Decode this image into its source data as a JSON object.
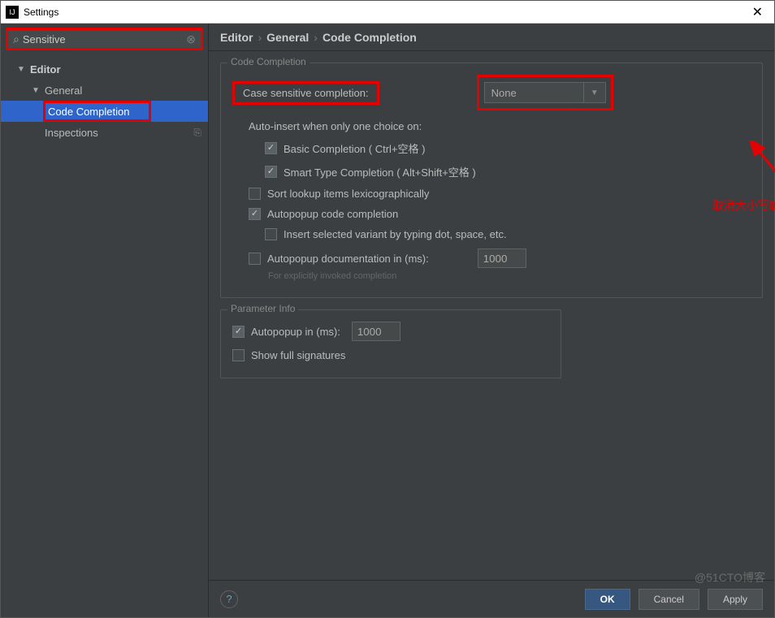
{
  "titlebar": {
    "title": "Settings"
  },
  "search": {
    "value": "Sensitive"
  },
  "tree": {
    "editor": "Editor",
    "general": "General",
    "code_completion": "Code Completion",
    "inspections": "Inspections"
  },
  "breadcrumb": {
    "p1": "Editor",
    "p2": "General",
    "p3": "Code Completion"
  },
  "section": {
    "code_completion_legend": "Code Completion",
    "case_sensitive_label": "Case sensitive completion:",
    "case_sensitive_value": "None",
    "auto_insert_label": "Auto-insert when only one choice on:",
    "basic_completion": "Basic Completion ( Ctrl+空格 )",
    "smart_type_completion": "Smart Type Completion ( Alt+Shift+空格 )",
    "sort_lookup": "Sort lookup items lexicographically",
    "autopopup_code": "Autopopup code completion",
    "insert_selected": "Insert selected variant by typing dot, space, etc.",
    "autopopup_doc_label": "Autopopup documentation in (ms):",
    "autopopup_doc_value": "1000",
    "autopopup_doc_hint": "For explicitly invoked completion",
    "param_info_legend": "Parameter Info",
    "autopopup_in_label": "Autopopup in (ms):",
    "autopopup_in_value": "1000",
    "show_full_sig": "Show full signatures"
  },
  "annotation": "取消大小写敏感,让代码提示更丰富齐全.",
  "footer": {
    "ok": "OK",
    "cancel": "Cancel",
    "apply": "Apply"
  },
  "watermark": "@51CTO博客"
}
